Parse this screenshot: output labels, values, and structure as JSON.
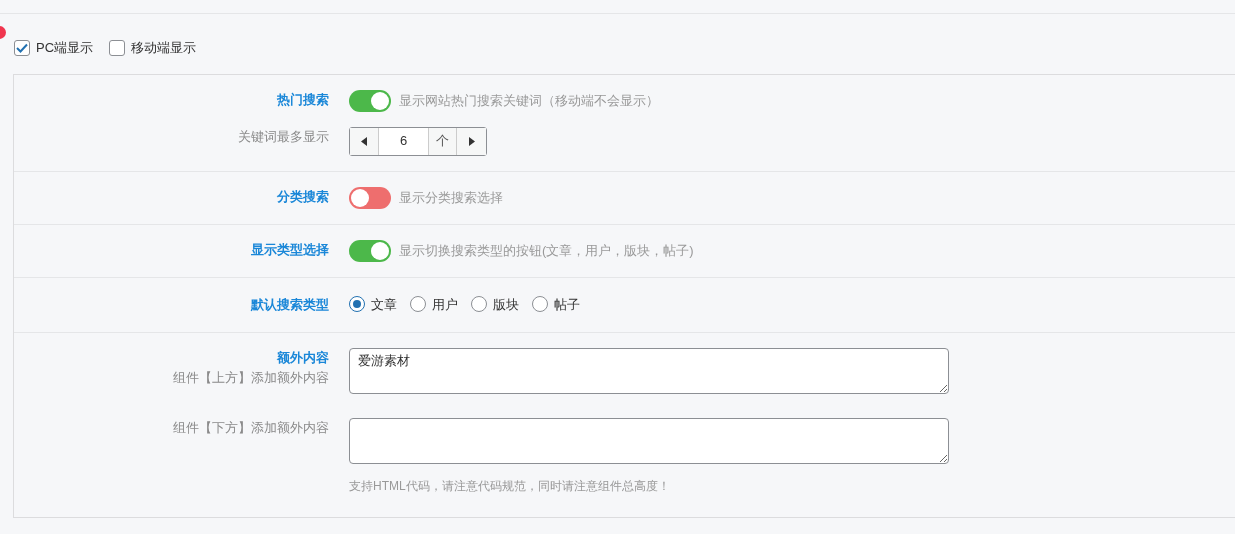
{
  "display_options": [
    {
      "label": "PC端显示",
      "checked": true
    },
    {
      "label": "移动端显示",
      "checked": false
    }
  ],
  "sections": [
    {
      "rows": [
        {
          "kind": "toggle",
          "label": "热门搜索",
          "on": true,
          "description": "显示网站热门搜索关键词（移动端不会显示）"
        },
        {
          "kind": "stepper",
          "label": "关键词最多显示",
          "value": "6",
          "unit": "个"
        }
      ]
    },
    {
      "rows": [
        {
          "kind": "toggle",
          "label": "分类搜索",
          "on": false,
          "description": "显示分类搜索选择"
        }
      ]
    },
    {
      "rows": [
        {
          "kind": "toggle",
          "label": "显示类型选择",
          "on": true,
          "description": "显示切换搜索类型的按钮(文章，用户，版块，帖子)"
        }
      ]
    },
    {
      "rows": [
        {
          "kind": "radio",
          "label": "默认搜索类型",
          "options": [
            {
              "label": "文章",
              "selected": true
            },
            {
              "label": "用户",
              "selected": false
            },
            {
              "label": "版块",
              "selected": false
            },
            {
              "label": "帖子",
              "selected": false
            }
          ]
        }
      ]
    },
    {
      "rows": [
        {
          "kind": "textarea",
          "label": "额外内容",
          "sublabel": "组件【上方】添加额外内容",
          "value": "爱游素材"
        },
        {
          "kind": "textarea",
          "sublabel": "组件【下方】添加额外内容",
          "value": "",
          "hint": "支持HTML代码，请注意代码规范，同时请注意组件总高度！"
        }
      ]
    }
  ]
}
